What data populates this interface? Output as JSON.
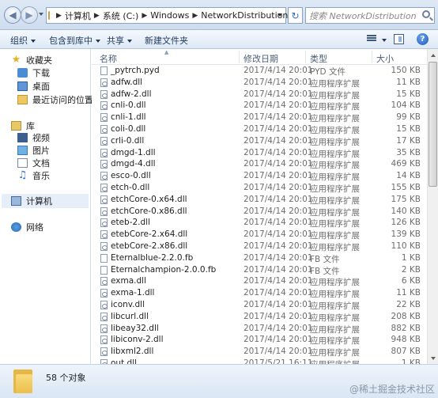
{
  "address": {
    "crumbs": [
      "计算机",
      "系统 (C:)",
      "Windows",
      "NetworkDistribution"
    ],
    "search_placeholder": "搜索 NetworkDistribution"
  },
  "toolbar": {
    "organize": "组织",
    "include_in_library": "包含到库中",
    "share": "共享",
    "new_folder": "新建文件夹"
  },
  "nav": {
    "favorites": "收藏夹",
    "downloads": "下载",
    "desktop": "桌面",
    "recent": "最近访问的位置",
    "libraries": "库",
    "videos": "视频",
    "pictures": "图片",
    "documents": "文档",
    "music": "音乐",
    "computer": "计算机",
    "network": "网络"
  },
  "columns": {
    "name": "名称",
    "date": "修改日期",
    "type": "类型",
    "size": "大小"
  },
  "files": [
    {
      "name": "_pytrch.pyd",
      "date": "2017/4/14 20:01",
      "type": "PYD 文件",
      "size": "150 KB"
    },
    {
      "name": "adfw.dll",
      "date": "2017/4/14 20:01",
      "type": "应用程序扩展",
      "size": "11 KB"
    },
    {
      "name": "adfw-2.dll",
      "date": "2017/4/14 20:01",
      "type": "应用程序扩展",
      "size": "15 KB"
    },
    {
      "name": "cnli-0.dll",
      "date": "2017/4/14 20:01",
      "type": "应用程序扩展",
      "size": "104 KB"
    },
    {
      "name": "cnli-1.dll",
      "date": "2017/4/14 20:01",
      "type": "应用程序扩展",
      "size": "99 KB"
    },
    {
      "name": "coli-0.dll",
      "date": "2017/4/14 20:01",
      "type": "应用程序扩展",
      "size": "15 KB"
    },
    {
      "name": "crli-0.dll",
      "date": "2017/4/14 20:01",
      "type": "应用程序扩展",
      "size": "17 KB"
    },
    {
      "name": "dmgd-1.dll",
      "date": "2017/4/14 20:01",
      "type": "应用程序扩展",
      "size": "35 KB"
    },
    {
      "name": "dmgd-4.dll",
      "date": "2017/4/14 20:01",
      "type": "应用程序扩展",
      "size": "469 KB"
    },
    {
      "name": "esco-0.dll",
      "date": "2017/4/14 20:01",
      "type": "应用程序扩展",
      "size": "14 KB"
    },
    {
      "name": "etch-0.dll",
      "date": "2017/4/14 20:01",
      "type": "应用程序扩展",
      "size": "155 KB"
    },
    {
      "name": "etchCore-0.x64.dll",
      "date": "2017/4/14 20:01",
      "type": "应用程序扩展",
      "size": "175 KB"
    },
    {
      "name": "etchCore-0.x86.dll",
      "date": "2017/4/14 20:01",
      "type": "应用程序扩展",
      "size": "140 KB"
    },
    {
      "name": "eteb-2.dll",
      "date": "2017/4/14 20:01",
      "type": "应用程序扩展",
      "size": "126 KB"
    },
    {
      "name": "etebCore-2.x64.dll",
      "date": "2017/4/14 20:01",
      "type": "应用程序扩展",
      "size": "139 KB"
    },
    {
      "name": "etebCore-2.x86.dll",
      "date": "2017/4/14 20:01",
      "type": "应用程序扩展",
      "size": "110 KB"
    },
    {
      "name": "Eternalblue-2.2.0.fb",
      "date": "2017/4/14 20:01",
      "type": "FB 文件",
      "size": "1 KB"
    },
    {
      "name": "Eternalchampion-2.0.0.fb",
      "date": "2017/4/14 20:01",
      "type": "FB 文件",
      "size": "2 KB"
    },
    {
      "name": "exma.dll",
      "date": "2017/4/14 20:01",
      "type": "应用程序扩展",
      "size": "6 KB"
    },
    {
      "name": "exma-1.dll",
      "date": "2017/4/14 20:01",
      "type": "应用程序扩展",
      "size": "11 KB"
    },
    {
      "name": "iconv.dll",
      "date": "2017/4/14 20:01",
      "type": "应用程序扩展",
      "size": "22 KB"
    },
    {
      "name": "libcurl.dll",
      "date": "2017/4/14 20:01",
      "type": "应用程序扩展",
      "size": "208 KB"
    },
    {
      "name": "libeay32.dll",
      "date": "2017/4/14 20:01",
      "type": "应用程序扩展",
      "size": "882 KB"
    },
    {
      "name": "libiconv-2.dll",
      "date": "2017/4/14 20:01",
      "type": "应用程序扩展",
      "size": "948 KB"
    },
    {
      "name": "libxml2.dll",
      "date": "2017/4/14 20:01",
      "type": "应用程序扩展",
      "size": "807 KB"
    },
    {
      "name": "out.dll",
      "date": "2017/5/21 16:11",
      "type": "应用程序扩展",
      "size": "1 KB"
    }
  ],
  "details": {
    "item_count": "58 个对象"
  },
  "watermark": "@稀土掘金技术社区"
}
